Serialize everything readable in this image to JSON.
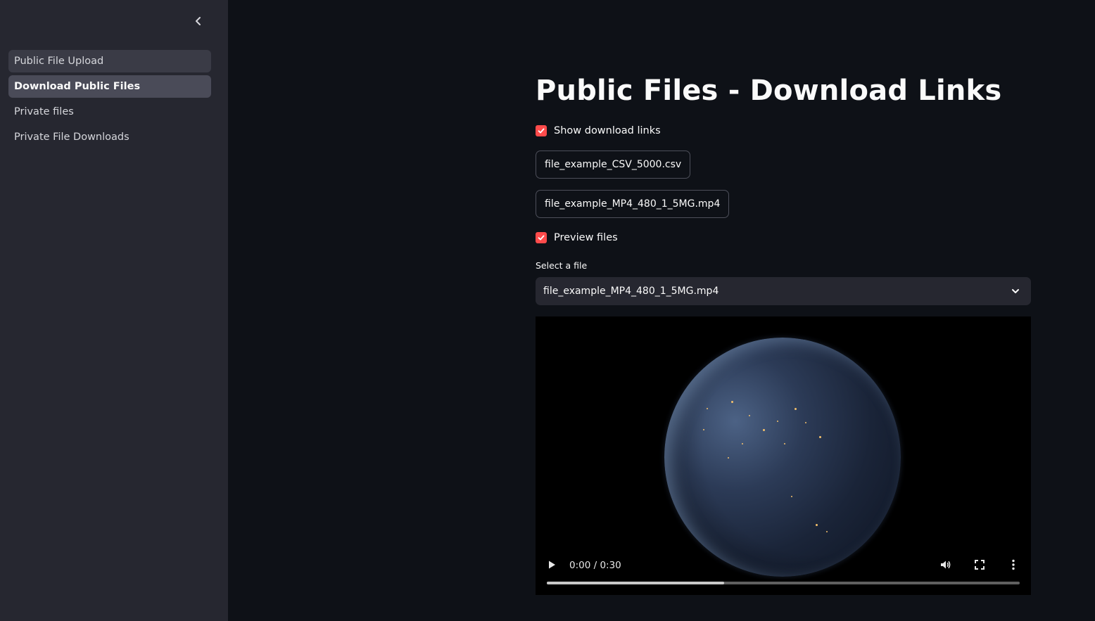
{
  "sidebar": {
    "collapse_icon": "chevron-left-icon",
    "items": [
      {
        "label": "Public File Upload"
      },
      {
        "label": "Download Public Files"
      },
      {
        "label": "Private files"
      },
      {
        "label": "Private File Downloads"
      }
    ],
    "active_index": 1
  },
  "main": {
    "title": "Public Files - Download Links",
    "show_links": {
      "label": "Show download links",
      "checked": true
    },
    "download_buttons": [
      {
        "label": "file_example_CSV_5000.csv"
      },
      {
        "label": "file_example_MP4_480_1_5MG.mp4"
      }
    ],
    "preview": {
      "label": "Preview files",
      "checked": true
    },
    "select": {
      "label": "Select a file",
      "value": "file_example_MP4_480_1_5MG.mp4"
    },
    "video": {
      "time": "0:00 / 0:30",
      "buffered_fraction": 0.375,
      "icons": [
        "play-icon",
        "volume-icon",
        "fullscreen-icon",
        "more-options-icon"
      ]
    }
  },
  "colors": {
    "background": "#0e1117",
    "sidebar": "#262730",
    "accent": "#ff4b4b"
  }
}
